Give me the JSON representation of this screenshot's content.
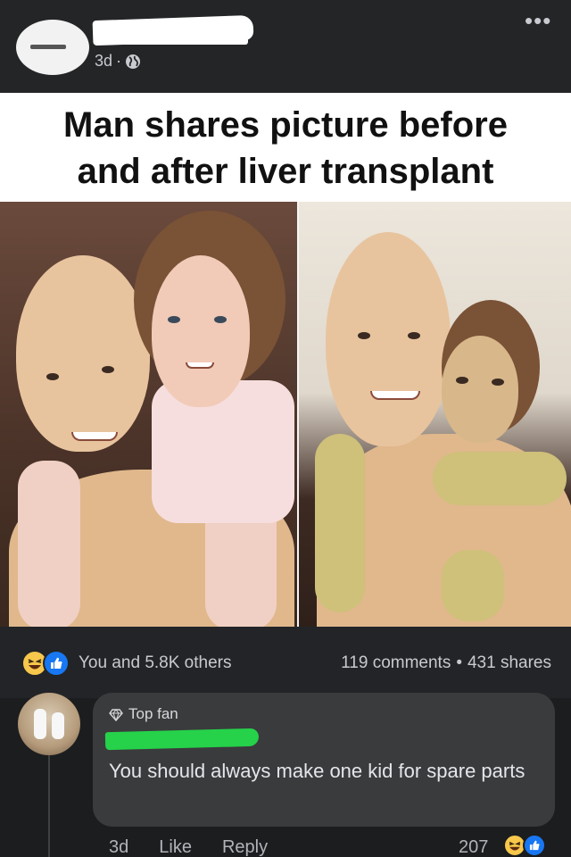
{
  "post": {
    "timestamp": "3d",
    "separator": "·",
    "caption_line1": "Man shares picture before",
    "caption_line2": "and after liver transplant",
    "more_label": "•••"
  },
  "reactions": {
    "summary": "You and 5.8K others",
    "comments": "119 comments",
    "dot": "•",
    "shares": "431 shares"
  },
  "comment": {
    "badge": "Top fan",
    "text": "You should always make one kid for spare parts",
    "time": "3d",
    "like_label": "Like",
    "reply_label": "Reply",
    "reaction_count": "207"
  },
  "colors": {
    "background": "#1c1d1f",
    "bubble": "#3a3b3c",
    "like_blue": "#1877f2",
    "haha_yellow": "#f7c84c",
    "redaction_green": "#25d24a"
  },
  "icons": [
    "globe-icon",
    "more-options-icon",
    "haha-reaction-icon",
    "like-reaction-icon",
    "diamond-icon"
  ]
}
